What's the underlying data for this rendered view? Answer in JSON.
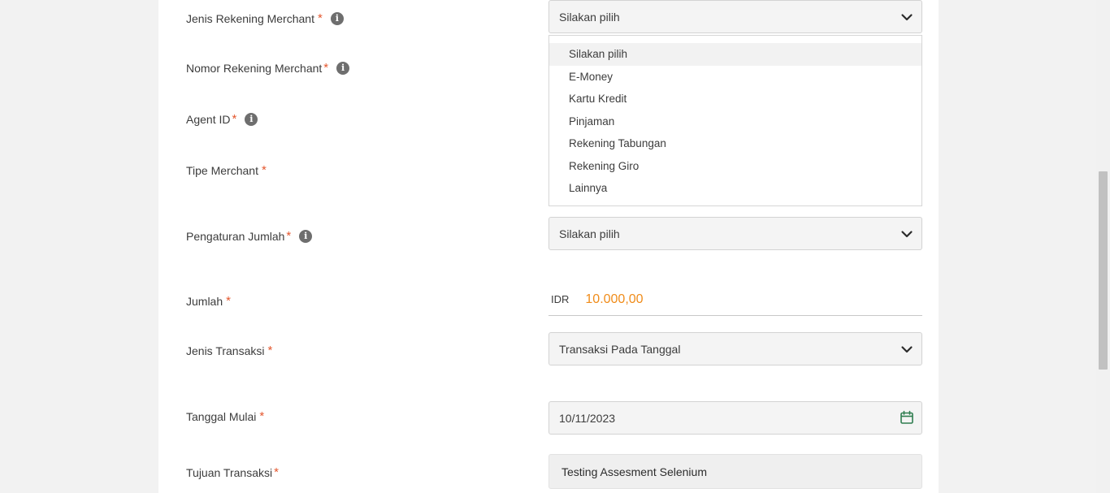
{
  "form": {
    "fields": [
      {
        "label": "Jenis Rekening Merchant",
        "required": "*"
      },
      {
        "label": "Nomor Rekening Merchant",
        "required": "*"
      },
      {
        "label": "Agent ID",
        "required": "*"
      },
      {
        "label": "Tipe Merchant",
        "required": "*"
      },
      {
        "label": "Pengaturan Jumlah",
        "required": "*"
      },
      {
        "label": "Jumlah",
        "required": "*"
      },
      {
        "label": "Jenis Transaksi",
        "required": "*"
      },
      {
        "label": "Tanggal Mulai",
        "required": "*"
      },
      {
        "label": "Tujuan Transaksi",
        "required": "*"
      }
    ],
    "info_glyph": "i",
    "jenis_rekening_value": "Silakan pilih",
    "jenis_rekening_options": [
      "Silakan pilih",
      "E-Money",
      "Kartu Kredit",
      "Pinjaman",
      "Rekening Tabungan",
      "Rekening Giro",
      "Lainnya"
    ],
    "pengaturan_jumlah_value": "Silakan pilih",
    "jumlah_currency": "IDR",
    "jumlah_value": "10.000,00",
    "jenis_transaksi_value": "Transaksi Pada Tanggal",
    "tanggal_mulai_value": "10/11/2023",
    "tujuan_transaksi_value": "Testing Assesment Selenium"
  },
  "icons": {
    "info": "info-icon",
    "chevron": "chevron-down-icon",
    "calendar": "calendar-icon"
  },
  "colors": {
    "required": "#e4572e",
    "amount": "#f08c1a",
    "calendar": "#2e7d4f"
  }
}
